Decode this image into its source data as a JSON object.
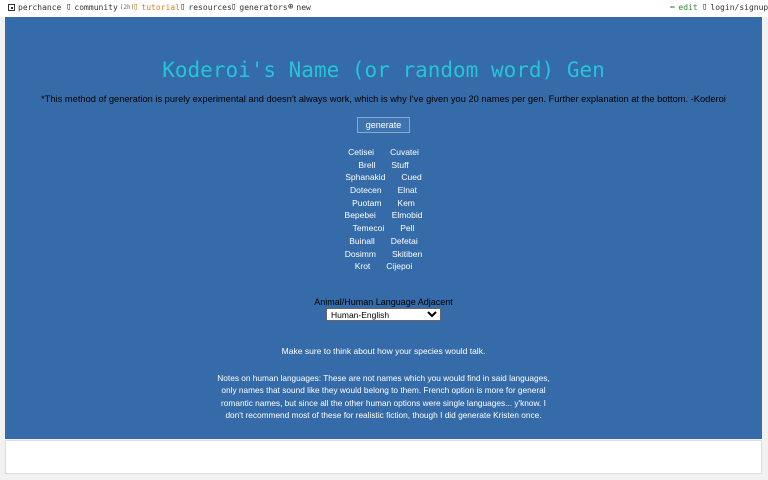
{
  "topbar": {
    "perchance": "perchance",
    "community": "community",
    "community_count": "(2h)",
    "tutorial": "tutorial",
    "resources": "resources",
    "generators": "generators",
    "new": "new",
    "edit": "edit",
    "login": "login/signup"
  },
  "icons": {
    "dice": "dice-icon",
    "chat": "chat-icon",
    "book": "book-icon",
    "folder": "folder-icon",
    "grid": "grid-icon",
    "plus": "plus-circle-icon",
    "pencil": "pencil-icon",
    "user": "user-icon"
  },
  "colors": {
    "panel": "#356ba8",
    "title": "#25c4da",
    "tutorial": "#e07a1a",
    "edit": "#2e8b2e"
  },
  "main": {
    "title": "Koderoi's Name (or random word) Gen",
    "subtitle": "*This method of generation is purely experimental and doesn't always work, which is why I've given you 20 names per gen. Further explanation at the bottom. -Koderoi",
    "generate_label": "generate",
    "names": [
      [
        "Cetisei",
        "Cuvatei"
      ],
      [
        "Brell",
        "Stuff"
      ],
      [
        "Sphanakid",
        "Cued"
      ],
      [
        "Dotecen",
        "Elnat"
      ],
      [
        "Puotam",
        "Kem"
      ],
      [
        "Bepebei",
        "Elmobid"
      ],
      [
        "Temecoi",
        "Pell"
      ],
      [
        "Buinall",
        "Defetai"
      ],
      [
        "Dosimm",
        "Skitiben"
      ],
      [
        "Krot",
        "Cijepoi"
      ]
    ],
    "language_label": "Animal/Human Language Adjacent",
    "language_selected": "Human-English",
    "think_text": "Make sure to think about how your species would talk.",
    "notes": "Notes on human languages: These are not names which you would find in said languages, only names that sound like they would belong to them. French option is more for general romantic names, but since all the other human options were single languages... y'know. I don't recommend most of these for realistic fiction, though I did generate Kristen once."
  }
}
